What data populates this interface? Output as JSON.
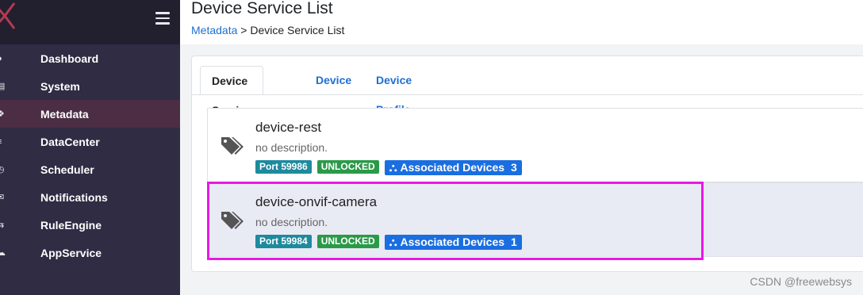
{
  "sidebar": {
    "items": [
      {
        "label": "Dashboard",
        "icon": "gauge-icon"
      },
      {
        "label": "System",
        "icon": "server-icon"
      },
      {
        "label": "Metadata",
        "icon": "cubes-icon",
        "active": true
      },
      {
        "label": "DataCenter",
        "icon": "database-icon"
      },
      {
        "label": "Scheduler",
        "icon": "clock-icon"
      },
      {
        "label": "Notifications",
        "icon": "envelope-icon"
      },
      {
        "label": "RuleEngine",
        "icon": "rules-icon"
      },
      {
        "label": "AppService",
        "icon": "cloud-icon"
      }
    ]
  },
  "header": {
    "title": "Device Service List",
    "breadcrumb_link": "Metadata",
    "breadcrumb_sep": " > ",
    "breadcrumb_current": "Device Service List"
  },
  "tabs": [
    {
      "label": "Device Service",
      "active": true
    },
    {
      "label": "Device"
    },
    {
      "label": "Device Profile"
    }
  ],
  "services": [
    {
      "name": "device-rest",
      "description": "no description.",
      "port": "Port 59986",
      "lock": "UNLOCKED",
      "assoc_label": "Associated Devices",
      "assoc_count": "3"
    },
    {
      "name": "device-onvif-camera",
      "description": "no description.",
      "port": "Port 59984",
      "lock": "UNLOCKED",
      "assoc_label": "Associated Devices",
      "assoc_count": "1"
    }
  ],
  "watermark": "CSDN @freewebsys",
  "colors": {
    "sidebar": "#2f2c44",
    "active": "#4b2d44",
    "link": "#1f6fd1",
    "highlight": "#e819e6"
  }
}
